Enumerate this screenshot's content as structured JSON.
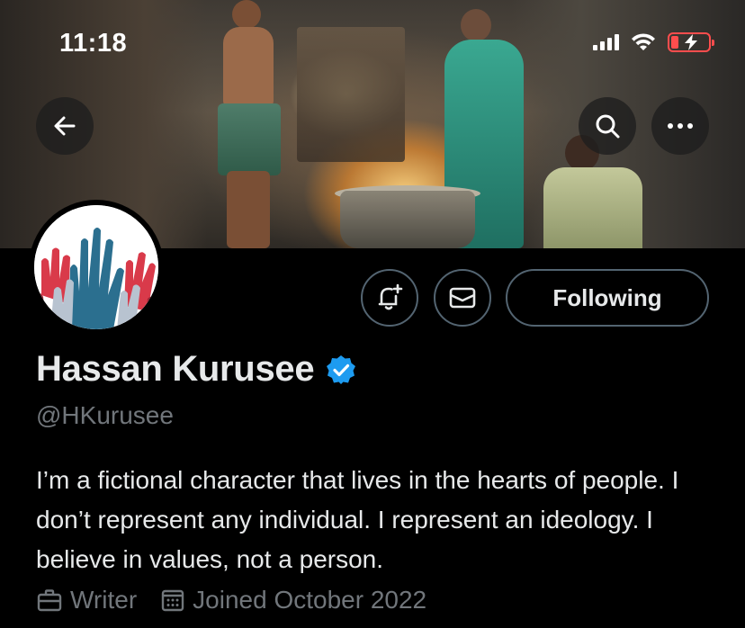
{
  "status_bar": {
    "time": "11:18",
    "battery_color": "#ff4d4d"
  },
  "header": {
    "back_icon": "arrow-left-icon",
    "search_icon": "search-icon",
    "more_icon": "more-horizontal-icon"
  },
  "profile": {
    "display_name": "Hassan Kurusee",
    "verified": true,
    "verified_color": "#1d9bf0",
    "handle": "@HKurusee",
    "bio": "I’m a fictional character that lives in the hearts of people. I don’t represent any individual. I represent an ideology. I believe in values, not a person.",
    "profession": "Writer",
    "joined": "Joined October 2022"
  },
  "actions": {
    "notify_icon": "bell-plus-icon",
    "message_icon": "envelope-icon",
    "following_label": "Following"
  },
  "colors": {
    "background": "#000000",
    "primary_text": "#e7e9ea",
    "secondary_text": "#71767b",
    "button_border": "#536471"
  }
}
